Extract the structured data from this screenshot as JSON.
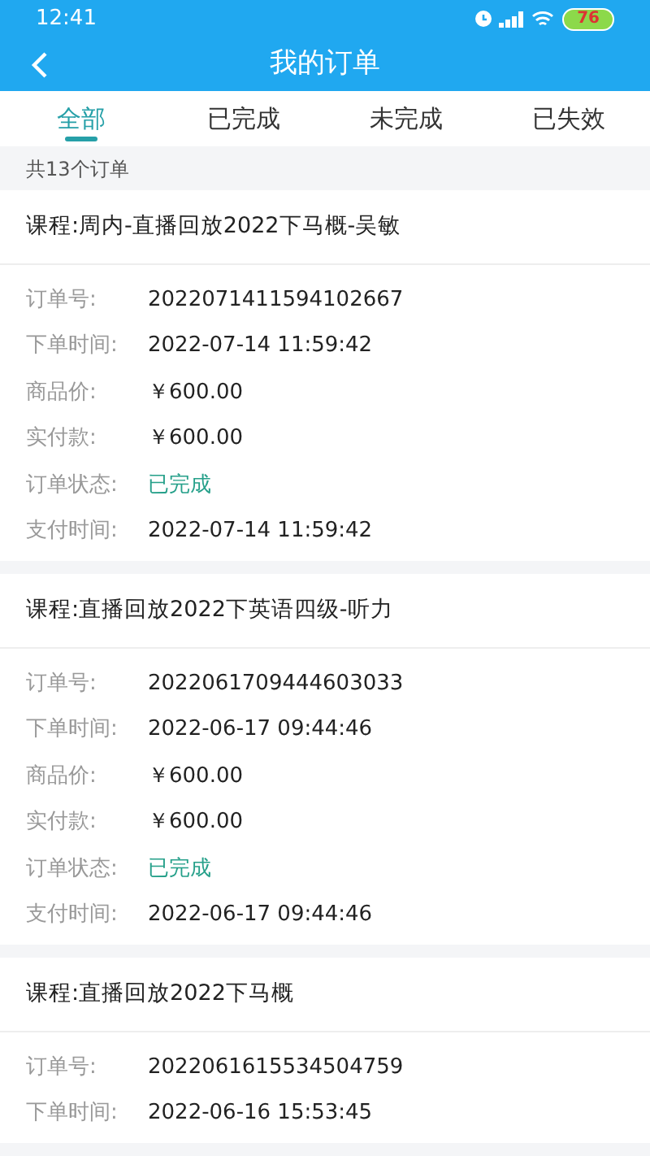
{
  "status_bar": {
    "time": "12:41",
    "battery": "76"
  },
  "header": {
    "title": "我的订单"
  },
  "tabs": [
    {
      "label": "全部",
      "selected": true
    },
    {
      "label": "已完成",
      "selected": false
    },
    {
      "label": "未完成",
      "selected": false
    },
    {
      "label": "已失效",
      "selected": false
    }
  ],
  "summary": "共13个订单",
  "orders": [
    {
      "course": "课程:周内-直播回放2022下马概-吴敏",
      "fields": [
        {
          "label": "订单号:",
          "value": "2022071411594102667",
          "kind": "text"
        },
        {
          "label": "下单时间:",
          "value": "2022-07-14 11:59:42",
          "kind": "text"
        },
        {
          "label": "商品价:",
          "value": "￥600.00",
          "kind": "text"
        },
        {
          "label": "实付款:",
          "value": "￥600.00",
          "kind": "text"
        },
        {
          "label": "订单状态:",
          "value": "已完成",
          "kind": "status"
        },
        {
          "label": "支付时间:",
          "value": "2022-07-14 11:59:42",
          "kind": "text"
        }
      ]
    },
    {
      "course": "课程:直播回放2022下英语四级-听力",
      "fields": [
        {
          "label": "订单号:",
          "value": "2022061709444603033",
          "kind": "text"
        },
        {
          "label": "下单时间:",
          "value": "2022-06-17 09:44:46",
          "kind": "text"
        },
        {
          "label": "商品价:",
          "value": "￥600.00",
          "kind": "text"
        },
        {
          "label": "实付款:",
          "value": "￥600.00",
          "kind": "text"
        },
        {
          "label": "订单状态:",
          "value": "已完成",
          "kind": "status"
        },
        {
          "label": "支付时间:",
          "value": "2022-06-17 09:44:46",
          "kind": "text"
        }
      ]
    },
    {
      "course": "课程:直播回放2022下马概",
      "fields": [
        {
          "label": "订单号:",
          "value": "2022061615534504759",
          "kind": "text"
        },
        {
          "label": "下单时间:",
          "value": "2022-06-16 15:53:45",
          "kind": "text"
        }
      ]
    }
  ]
}
